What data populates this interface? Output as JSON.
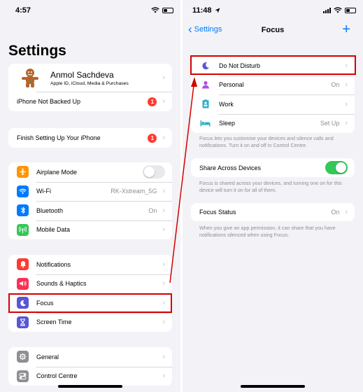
{
  "left": {
    "status_time": "4:57",
    "title": "Settings",
    "profile": {
      "name": "Anmol Sachdeva",
      "subtitle": "Apple ID, iCloud, Media & Purchases",
      "backup_label": "iPhone Not Backed Up",
      "backup_badge": "1"
    },
    "setup": {
      "label": "Finish Setting Up Your iPhone",
      "badge": "1"
    },
    "connectivity": [
      {
        "label": "Airplane Mode",
        "icon": "airplane-icon",
        "color": "#ff9500",
        "toggle": false
      },
      {
        "label": "Wi-Fi",
        "icon": "wifi-icon",
        "color": "#007aff",
        "value": "RK-Xstream_5G"
      },
      {
        "label": "Bluetooth",
        "icon": "bluetooth-icon",
        "color": "#007aff",
        "value": "On"
      },
      {
        "label": "Mobile Data",
        "icon": "antenna-icon",
        "color": "#34c759"
      }
    ],
    "notifications_group": [
      {
        "label": "Notifications",
        "icon": "bell-icon",
        "color": "#ff3b30"
      },
      {
        "label": "Sounds & Haptics",
        "icon": "speaker-icon",
        "color": "#ff2d55"
      },
      {
        "label": "Focus",
        "icon": "moon-icon",
        "color": "#5856d6"
      },
      {
        "label": "Screen Time",
        "icon": "hourglass-icon",
        "color": "#5856d6"
      }
    ],
    "general_group": [
      {
        "label": "General",
        "icon": "gear-icon",
        "color": "#8e8e93"
      },
      {
        "label": "Control Centre",
        "icon": "switches-icon",
        "color": "#8e8e93"
      }
    ]
  },
  "right": {
    "status_time": "11:48",
    "back_label": "Settings",
    "nav_title": "Focus",
    "add_label": "+",
    "focus_modes": [
      {
        "label": "Do Not Disturb",
        "icon": "moon-icon",
        "color": "#5856d6",
        "value": ""
      },
      {
        "label": "Personal",
        "icon": "person-icon",
        "color": "#af52de",
        "value": "On"
      },
      {
        "label": "Work",
        "icon": "badge-icon",
        "color": "#30b0c7",
        "value": ""
      },
      {
        "label": "Sleep",
        "icon": "bed-icon",
        "color": "#30b0c7",
        "value": "Set Up"
      }
    ],
    "focus_footer": "Focus lets you customise your devices and silence calls and notifications. Turn it on and off in Control Centre.",
    "share": {
      "label": "Share Across Devices",
      "toggle": true
    },
    "share_footer": "Focus is shared across your devices, and turning one on for this device will turn it on for all of them.",
    "status": {
      "label": "Focus Status",
      "value": "On"
    },
    "status_footer": "When you give an app permission, it can share that you have notifications silenced when using Focus."
  },
  "highlight_color": "#d40000"
}
